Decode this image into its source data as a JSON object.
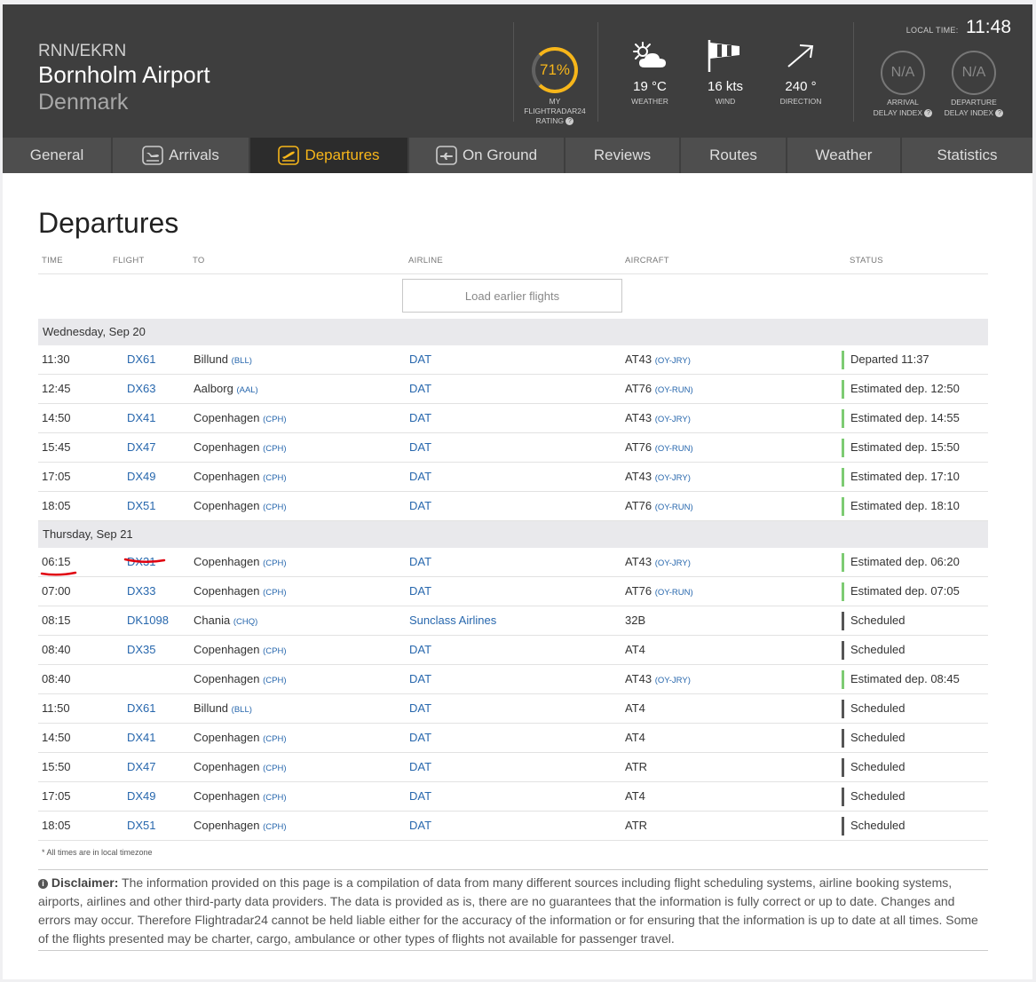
{
  "header": {
    "code": "RNN/EKRN",
    "airport": "Bornholm Airport",
    "country": "Denmark",
    "local_time_label": "LOCAL TIME:",
    "local_time": "11:48",
    "rating": {
      "value": "71%",
      "percent": 71,
      "label_1": "MY",
      "label_2": "FLIGHTRADAR24",
      "label_3": "RATING"
    },
    "weather": {
      "temp": "19 °C",
      "temp_label": "WEATHER",
      "wind": "16 kts",
      "wind_label": "WIND",
      "direction": "240 °",
      "direction_label": "DIRECTION"
    },
    "arrival_delay": {
      "value": "N/A",
      "label_1": "ARRIVAL",
      "label_2": "DELAY INDEX"
    },
    "departure_delay": {
      "value": "N/A",
      "label_1": "DEPARTURE",
      "label_2": "DELAY INDEX"
    }
  },
  "nav": {
    "tabs": [
      {
        "label": "General",
        "icon": ""
      },
      {
        "label": "Arrivals",
        "icon": "arrivals-plane-icon"
      },
      {
        "label": "Departures",
        "icon": "departures-plane-icon",
        "active": true
      },
      {
        "label": "On Ground",
        "icon": "on-ground-plane-icon"
      },
      {
        "label": "Reviews",
        "icon": ""
      },
      {
        "label": "Routes",
        "icon": ""
      },
      {
        "label": "Weather",
        "icon": ""
      },
      {
        "label": "Statistics",
        "icon": ""
      }
    ]
  },
  "main": {
    "title": "Departures",
    "columns": {
      "time": "TIME",
      "flight": "FLIGHT",
      "to": "TO",
      "airline": "AIRLINE",
      "aircraft": "AIRCRAFT",
      "status": "STATUS"
    },
    "load_earlier": "Load earlier flights",
    "days": [
      {
        "label": "Wednesday, Sep 20",
        "flights": [
          {
            "time": "11:30",
            "flight": "DX61",
            "to": "Billund",
            "to_code": "(BLL)",
            "airline": "DAT",
            "aircraft": "AT43",
            "reg": "(OY-JRY)",
            "status": "Departed 11:37",
            "status_color": "#7dcb73"
          },
          {
            "time": "12:45",
            "flight": "DX63",
            "to": "Aalborg",
            "to_code": "(AAL)",
            "airline": "DAT",
            "aircraft": "AT76",
            "reg": "(OY-RUN)",
            "status": "Estimated dep. 12:50",
            "status_color": "#7dcb73"
          },
          {
            "time": "14:50",
            "flight": "DX41",
            "to": "Copenhagen",
            "to_code": "(CPH)",
            "airline": "DAT",
            "aircraft": "AT43",
            "reg": "(OY-JRY)",
            "status": "Estimated dep. 14:55",
            "status_color": "#7dcb73"
          },
          {
            "time": "15:45",
            "flight": "DX47",
            "to": "Copenhagen",
            "to_code": "(CPH)",
            "airline": "DAT",
            "aircraft": "AT76",
            "reg": "(OY-RUN)",
            "status": "Estimated dep. 15:50",
            "status_color": "#7dcb73"
          },
          {
            "time": "17:05",
            "flight": "DX49",
            "to": "Copenhagen",
            "to_code": "(CPH)",
            "airline": "DAT",
            "aircraft": "AT43",
            "reg": "(OY-JRY)",
            "status": "Estimated dep. 17:10",
            "status_color": "#7dcb73"
          },
          {
            "time": "18:05",
            "flight": "DX51",
            "to": "Copenhagen",
            "to_code": "(CPH)",
            "airline": "DAT",
            "aircraft": "AT76",
            "reg": "(OY-RUN)",
            "status": "Estimated dep. 18:10",
            "status_color": "#7dcb73"
          }
        ]
      },
      {
        "label": "Thursday, Sep 21",
        "flights": [
          {
            "time": "06:15",
            "flight": "DX31",
            "to": "Copenhagen",
            "to_code": "(CPH)",
            "airline": "DAT",
            "aircraft": "AT43",
            "reg": "(OY-JRY)",
            "status": "Estimated dep. 06:20",
            "status_color": "#7dcb73",
            "underlined": true
          },
          {
            "time": "07:00",
            "flight": "DX33",
            "to": "Copenhagen",
            "to_code": "(CPH)",
            "airline": "DAT",
            "aircraft": "AT76",
            "reg": "(OY-RUN)",
            "status": "Estimated dep. 07:05",
            "status_color": "#7dcb73"
          },
          {
            "time": "08:15",
            "flight": "DK1098",
            "to": "Chania",
            "to_code": "(CHQ)",
            "airline": "Sunclass Airlines",
            "aircraft": "32B",
            "reg": "",
            "status": "Scheduled",
            "status_color": "#555555"
          },
          {
            "time": "08:40",
            "flight": "DX35",
            "to": "Copenhagen",
            "to_code": "(CPH)",
            "airline": "DAT",
            "aircraft": "AT4",
            "reg": "",
            "status": "Scheduled",
            "status_color": "#555555"
          },
          {
            "time": "08:40",
            "flight": "",
            "to": "Copenhagen",
            "to_code": "(CPH)",
            "airline": "DAT",
            "aircraft": "AT43",
            "reg": "(OY-JRY)",
            "status": "Estimated dep. 08:45",
            "status_color": "#7dcb73"
          },
          {
            "time": "11:50",
            "flight": "DX61",
            "to": "Billund",
            "to_code": "(BLL)",
            "airline": "DAT",
            "aircraft": "AT4",
            "reg": "",
            "status": "Scheduled",
            "status_color": "#555555"
          },
          {
            "time": "14:50",
            "flight": "DX41",
            "to": "Copenhagen",
            "to_code": "(CPH)",
            "airline": "DAT",
            "aircraft": "AT4",
            "reg": "",
            "status": "Scheduled",
            "status_color": "#555555"
          },
          {
            "time": "15:50",
            "flight": "DX47",
            "to": "Copenhagen",
            "to_code": "(CPH)",
            "airline": "DAT",
            "aircraft": "ATR",
            "reg": "",
            "status": "Scheduled",
            "status_color": "#555555"
          },
          {
            "time": "17:05",
            "flight": "DX49",
            "to": "Copenhagen",
            "to_code": "(CPH)",
            "airline": "DAT",
            "aircraft": "AT4",
            "reg": "",
            "status": "Scheduled",
            "status_color": "#555555"
          },
          {
            "time": "18:05",
            "flight": "DX51",
            "to": "Copenhagen",
            "to_code": "(CPH)",
            "airline": "DAT",
            "aircraft": "ATR",
            "reg": "",
            "status": "Scheduled",
            "status_color": "#555555"
          }
        ]
      }
    ],
    "footnote": "* All times are in local timezone",
    "disclaimer_label": "Disclaimer:",
    "disclaimer_text": "The information provided on this page is a compilation of data from many different sources including flight scheduling systems, airline booking systems, airports, airlines and other third-party data providers. The data is provided as is, there are no guarantees that the information is fully correct or up to date. Changes and errors may occur. Therefore Flightradar24 cannot be held liable either for the accuracy of the information or for ensuring that the information is up to date at all times. Some of the flights presented may be charter, cargo, ambulance or other types of flights not available for passenger travel."
  },
  "colors": {
    "accent": "#f7b61a",
    "link": "#2767ad",
    "header_bg": "#3e3e3e",
    "nav_bg": "#4e4e4e",
    "annotation": "#e0000f"
  }
}
